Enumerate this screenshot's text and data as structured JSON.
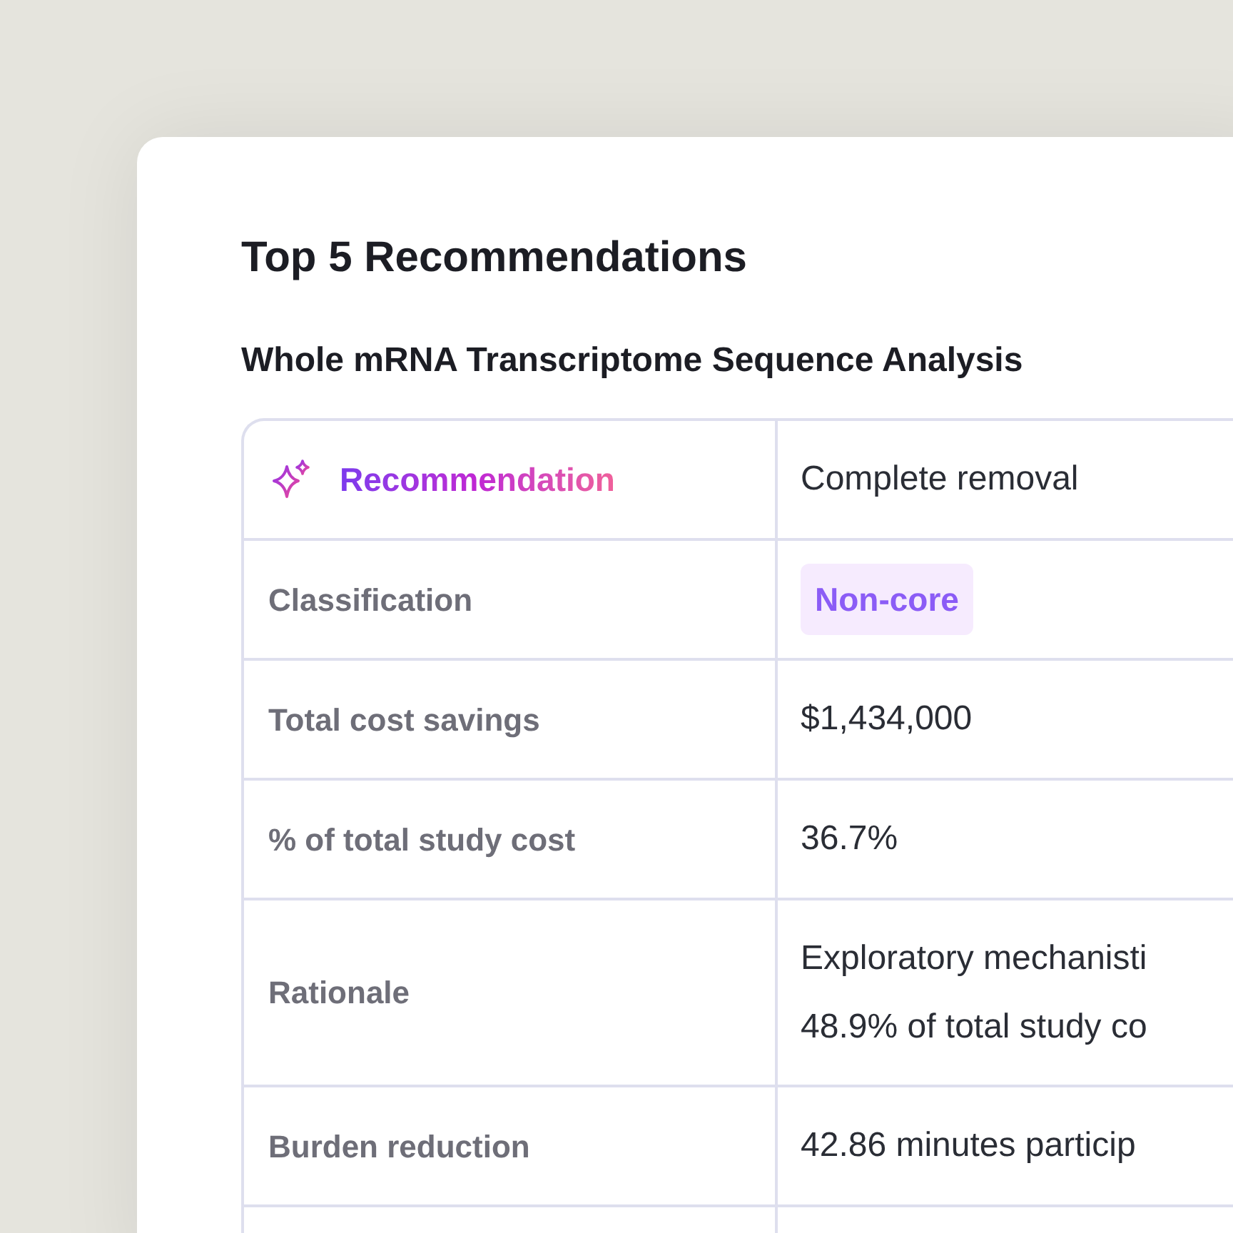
{
  "title": "Top 5 Recommendations",
  "subtitle": "Whole mRNA Transcriptome Sequence Analysis",
  "rows": [
    {
      "kind": "highlight",
      "label": "Recommendation",
      "value": [
        "Complete removal"
      ]
    },
    {
      "kind": "badge",
      "label": "Classification",
      "value": [
        "Non-core"
      ]
    },
    {
      "kind": "text",
      "label": "Total cost savings",
      "value": [
        "$1,434,000"
      ]
    },
    {
      "kind": "text",
      "label": "% of total study cost",
      "value": [
        "36.7%"
      ]
    },
    {
      "kind": "text",
      "label": "Rationale",
      "value": [
        "Exploratory mechanisti",
        "48.9% of total study co"
      ]
    },
    {
      "kind": "text",
      "label": "Burden reduction",
      "value": [
        "42.86 minutes particip"
      ]
    }
  ]
}
